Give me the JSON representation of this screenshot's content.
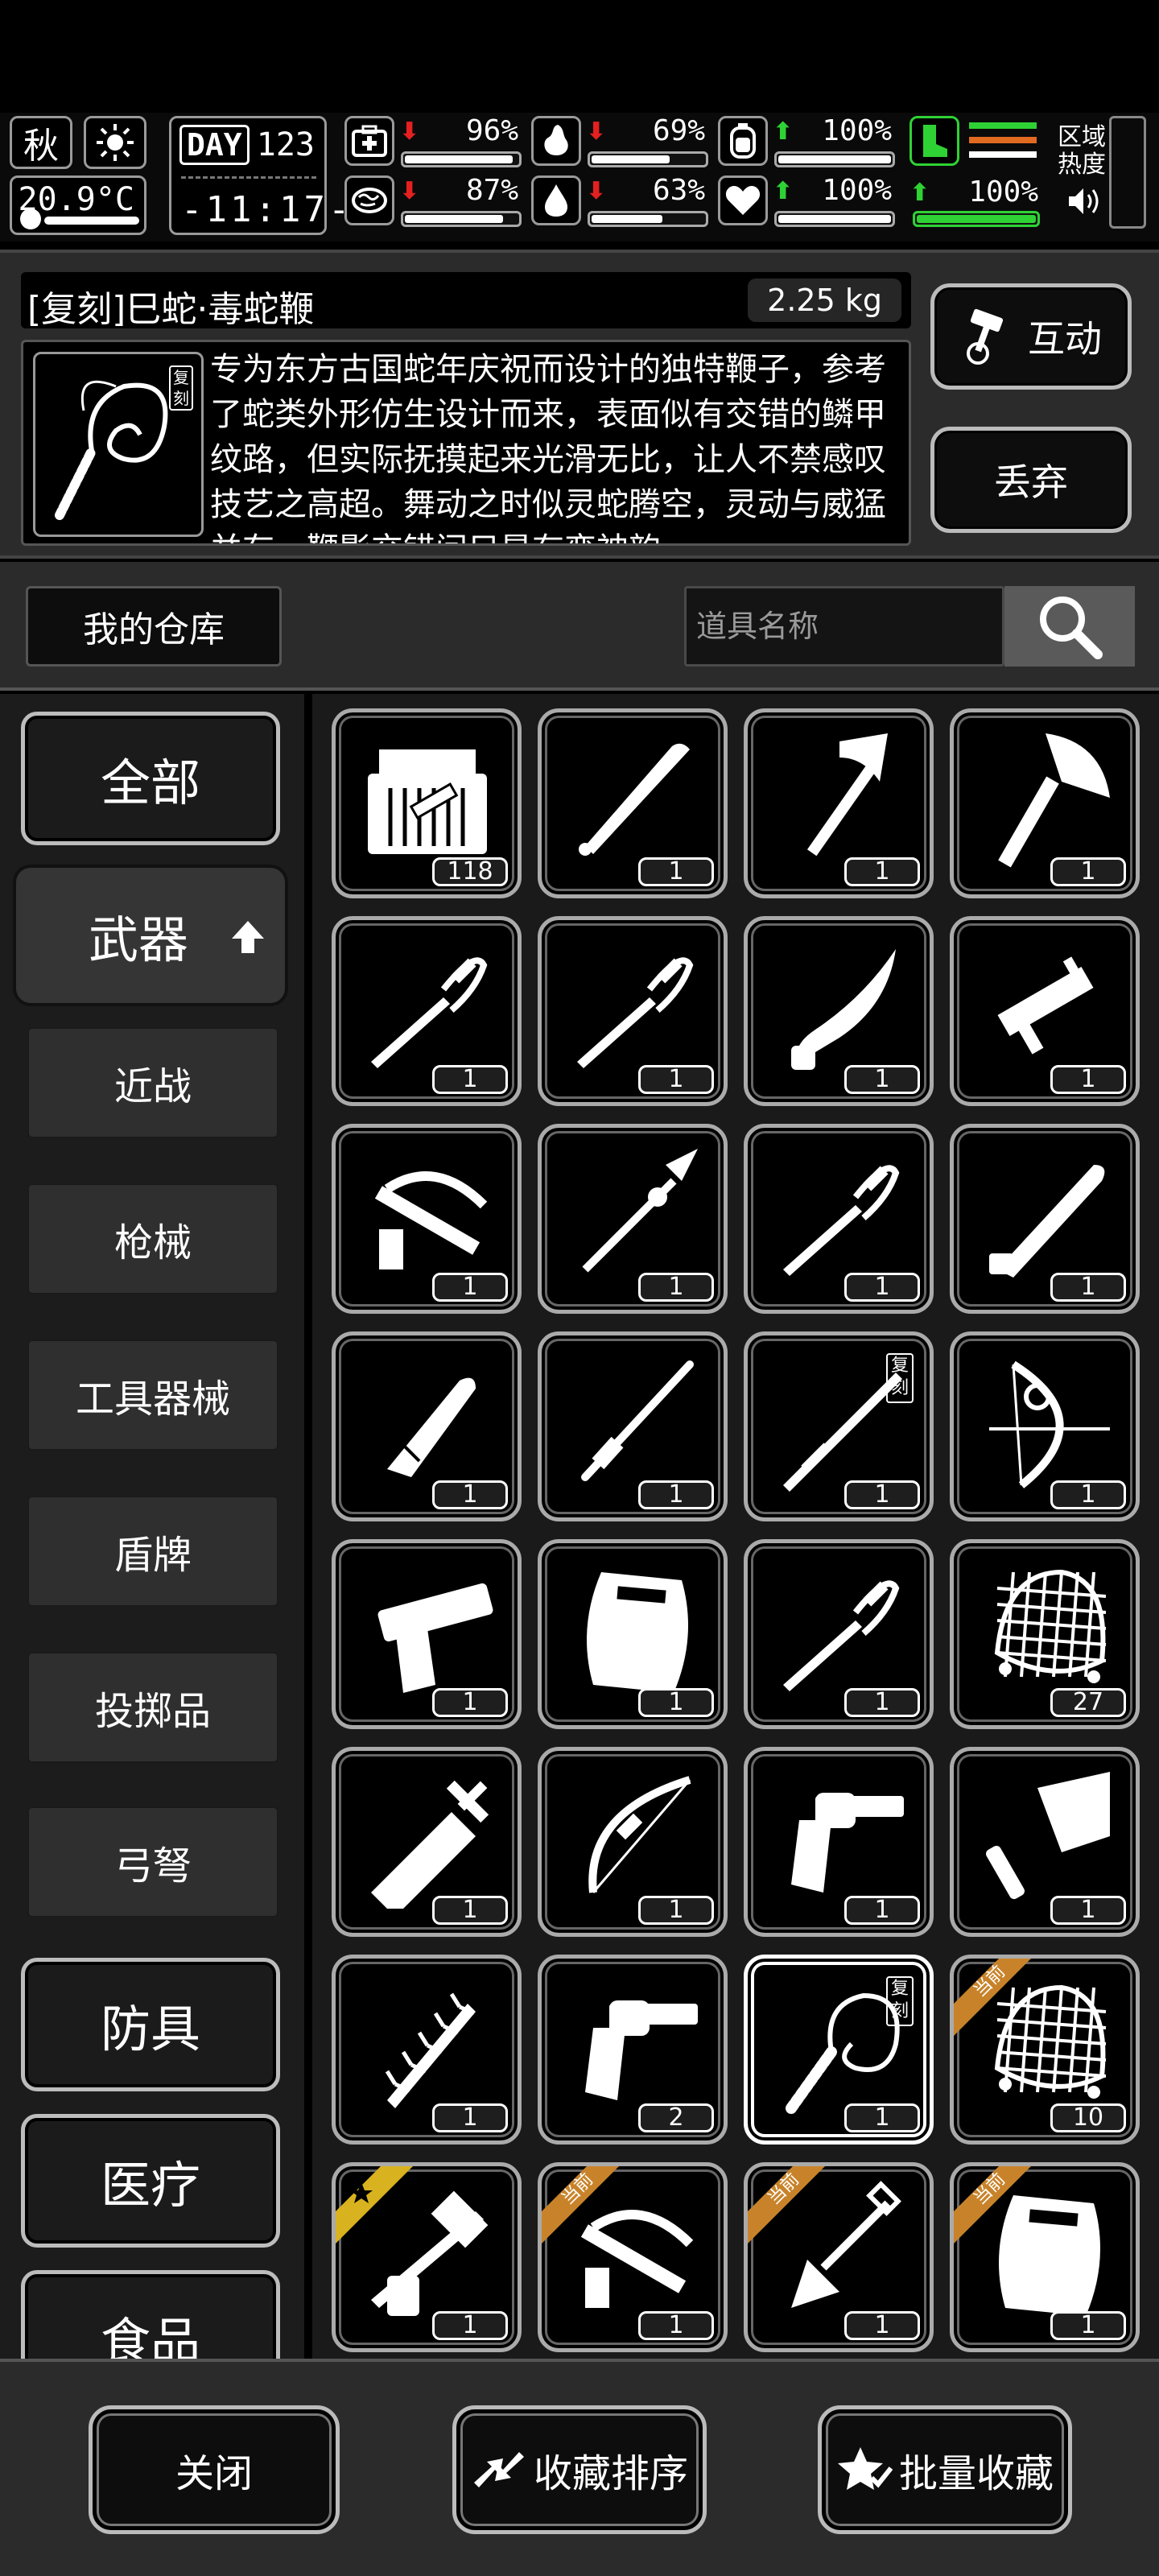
{
  "status": {
    "season": "秋",
    "temperature": "20.9°C",
    "day_label": "DAY",
    "day_number": "123",
    "time": "-11:17-",
    "stats": [
      {
        "icon": "medkit-icon",
        "trend": "down",
        "value": "96%",
        "level": 0.96
      },
      {
        "icon": "stomach-icon",
        "trend": "down",
        "value": "69%",
        "level": 0.69
      },
      {
        "icon": "battery-icon",
        "trend": "up",
        "value": "100%",
        "level": 1.0
      },
      {
        "icon": "brain-icon",
        "trend": "down",
        "value": "87%",
        "level": 0.87
      },
      {
        "icon": "water-drop-icon",
        "trend": "down",
        "value": "63%",
        "level": 0.63
      },
      {
        "icon": "heart-icon",
        "trend": "up",
        "value": "100%",
        "level": 1.0
      }
    ],
    "stamina": {
      "icon": "boot-icon",
      "trend": "up",
      "value": "100%",
      "level": 1.0
    },
    "zone_heat": "区域\n热度",
    "colors": {
      "down": "#e42020",
      "up": "#2fd234"
    }
  },
  "item": {
    "name": "[复刻]巳蛇·毒蛇鞭",
    "weight": "2.25 kg",
    "description": "专为东方古国蛇年庆祝而设计的独特鞭子，参考了蛇类外形仿生设计而来，表面似有交错的鳞甲纹路，但实际抚摸起来光滑无比，让人不禁感叹技艺之高超。舞动之时似灵蛇腾空，灵动与威猛并存，鞭影交错间只是有变神韵",
    "thumb_tag": "复刻",
    "interact_label": "互动",
    "discard_label": "丢弃"
  },
  "warehouse": {
    "title": "我的仓库",
    "search_placeholder": "道具名称"
  },
  "sidebar": {
    "main_all": "全部",
    "main_weapons": "武器",
    "subs": [
      "近战",
      "枪械",
      "工具器械",
      "盾牌",
      "投掷品",
      "弓弩"
    ],
    "main_armor": "防具",
    "main_medical": "医疗",
    "main_food": "食品"
  },
  "grid": [
    {
      "icon": "ammo-crate-icon",
      "count": "118"
    },
    {
      "icon": "baseball-bat-icon",
      "count": "1"
    },
    {
      "icon": "fire-axe-icon",
      "count": "1"
    },
    {
      "icon": "hatchet-icon",
      "count": "1"
    },
    {
      "icon": "saber-icon",
      "count": "1"
    },
    {
      "icon": "saber-icon",
      "count": "1"
    },
    {
      "icon": "kukri-icon",
      "count": "1"
    },
    {
      "icon": "submachine-gun-icon",
      "count": "1"
    },
    {
      "icon": "crossbow-icon",
      "count": "1"
    },
    {
      "icon": "spear-icon",
      "count": "1"
    },
    {
      "icon": "saber-icon",
      "count": "1"
    },
    {
      "icon": "machete-icon",
      "count": "1"
    },
    {
      "icon": "combat-knife-icon",
      "count": "1"
    },
    {
      "icon": "baton-icon",
      "count": "1"
    },
    {
      "icon": "katana-icon",
      "count": "1",
      "tag": "复刻"
    },
    {
      "icon": "compound-bow-icon",
      "count": "1"
    },
    {
      "icon": "pistol-icon",
      "count": "1"
    },
    {
      "icon": "riot-shield-icon",
      "count": "1"
    },
    {
      "icon": "saber-icon",
      "count": "1"
    },
    {
      "icon": "throwing-net-icon",
      "count": "27"
    },
    {
      "icon": "broadsword-icon",
      "count": "1"
    },
    {
      "icon": "recurve-bow-icon",
      "count": "1"
    },
    {
      "icon": "revolver-icon",
      "count": "1"
    },
    {
      "icon": "cleaver-icon",
      "count": "1"
    },
    {
      "icon": "spiked-club-icon",
      "count": "1"
    },
    {
      "icon": "revolver-icon",
      "count": "2"
    },
    {
      "icon": "snake-whip-icon",
      "count": "1",
      "tag": "复刻",
      "selected": true
    },
    {
      "icon": "throwing-net-icon",
      "count": "10",
      "badge": "当前"
    },
    {
      "icon": "caliper-blade-icon",
      "count": "1",
      "badge": "star"
    },
    {
      "icon": "crossbow-icon",
      "count": "1",
      "badge": "当前"
    },
    {
      "icon": "shovel-icon",
      "count": "1",
      "badge": "当前"
    },
    {
      "icon": "riot-shield-icon",
      "count": "1",
      "badge": "当前"
    }
  ],
  "footer": {
    "close_label": "关闭",
    "sort_label": "收藏排序",
    "batch_label": "批量收藏"
  }
}
